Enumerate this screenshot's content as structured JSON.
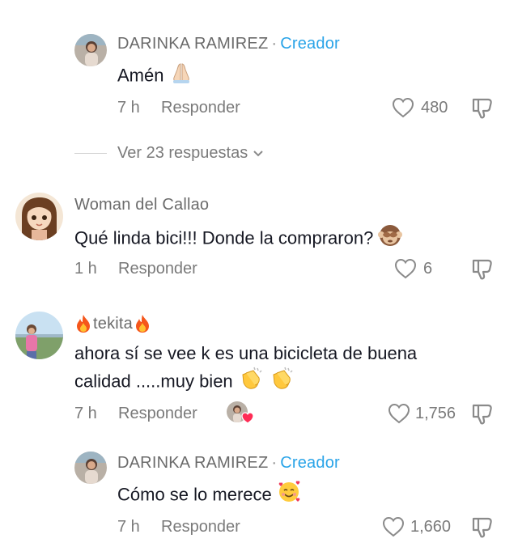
{
  "comments": [
    {
      "author": "DARINKA RAMIREZ",
      "badge": "Creador",
      "text": "Amén",
      "emojis": [
        "praying-hands"
      ],
      "time": "7 h",
      "reply_label": "Responder",
      "likes": "480"
    },
    {
      "view_replies": "Ver 23 respuestas"
    },
    {
      "author": "Woman del Callao",
      "text": "Qué linda bici!!! Donde la compraron?",
      "emojis": [
        "see-no-evil-monkey"
      ],
      "time": "1 h",
      "reply_label": "Responder",
      "likes": "6"
    },
    {
      "author": "tekita",
      "author_emojis": [
        "fire",
        "fire"
      ],
      "text_line1": "ahora sí se vee k es una bicicleta de buena",
      "text_line2": "calidad .....muy bien",
      "emojis": [
        "clapping-hands",
        "clapping-hands"
      ],
      "time": "7 h",
      "reply_label": "Responder",
      "likes": "1,756"
    },
    {
      "author": "DARINKA RAMIREZ",
      "badge": "Creador",
      "text": "Cómo se lo merece",
      "emojis": [
        "smiling-face-with-hearts"
      ],
      "time": "7 h",
      "reply_label": "Responder",
      "likes": "1,660"
    }
  ],
  "colors": {
    "creator": "#2aa4e8",
    "meta": "#7a7a7a",
    "text": "#161823",
    "heart_badge": "#fe2c55"
  }
}
